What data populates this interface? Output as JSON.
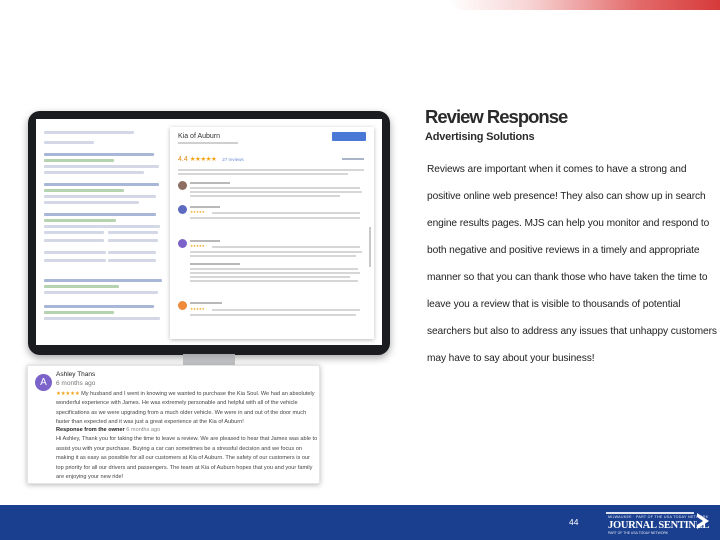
{
  "slide": {
    "title": "Review Response",
    "subtitle": "Advertising Solutions",
    "body": "Reviews are important when it comes to have a strong and positive online web presence! They also can show up in search engine results pages. MJS can help you monitor and respond to both negative and positive reviews in a timely and appropriate manner so that you can thank those who have taken the time to leave you a review that is visible to thousands of potential searchers but also to address any issues that unhappy customers may have to say about your business!",
    "page_number": "44"
  },
  "screen_panel": {
    "business_name": "Kia of Auburn",
    "rating": "4.4",
    "stars": "★★★★★",
    "review_count": "27 reviews"
  },
  "review_card": {
    "avatar_letter": "A",
    "reviewer_name": "Ashley Thans",
    "date": "6 months ago",
    "stars": "★★★★★",
    "text": "My husband and I went in knowing we wanted to purchase the Kia Soul. We had an absolutely wonderful experience with James. He was extremely personable and helpful with all of the vehicle specifications as we were upgrading from a much older vehicle. We were in and out of the door much faster than expected and it was just a great experience at the Kia of Auburn!",
    "owner_label": "Response from the owner",
    "owner_date": "6 months ago",
    "owner_text": "Hi Ashley, Thank you for taking the time to leave a review. We are pleased to hear that James was able to assist you with your purchase. Buying a car can sometimes be a stressful decision and we focus on making it as easy as possible for all our customers at Kia of Auburn. The safety of our customers is our top priority for all our drivers and passengers. The team at Kia of Auburn hopes that you and your family are enjoying your new ride!"
  },
  "logo": {
    "main": "JOURNAL SENTINEL",
    "small_top": "MILWAUKEE · PART OF THE USA TODAY NETWORK",
    "small_bottom": "PART OF THE USA TODAY NETWORK"
  },
  "colors": {
    "footer": "#1a3f8f",
    "accent_red": "#d63a3a",
    "star": "#f0a51b",
    "avatar": "#7b63c9"
  }
}
